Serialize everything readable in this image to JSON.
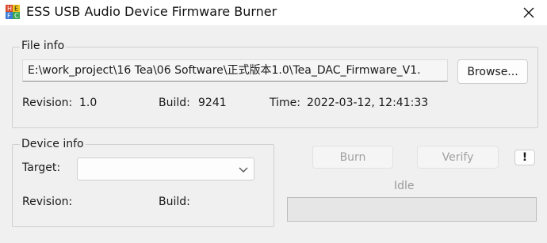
{
  "window": {
    "title": "ESS USB Audio Device Firmware Burner",
    "icon": "firmware-chip-icon"
  },
  "file_info": {
    "group_label": "File info",
    "path": "E:\\work_project\\16 Tea\\06 Software\\正式版本1.0\\Tea_DAC_Firmware_V1.",
    "browse_label": "Browse...",
    "revision_label": "Revision:",
    "revision_value": "1.0",
    "build_label": "Build:",
    "build_value": "9241",
    "time_label": "Time:",
    "time_value": "2022-03-12, 12:41:33"
  },
  "device_info": {
    "group_label": "Device info",
    "target_label": "Target:",
    "target_value": "",
    "revision_label": "Revision:",
    "build_label": "Build:"
  },
  "actions": {
    "burn_label": "Burn",
    "verify_label": "Verify",
    "alert_label": "!",
    "status_text": "Idle",
    "progress_fraction": 0
  }
}
